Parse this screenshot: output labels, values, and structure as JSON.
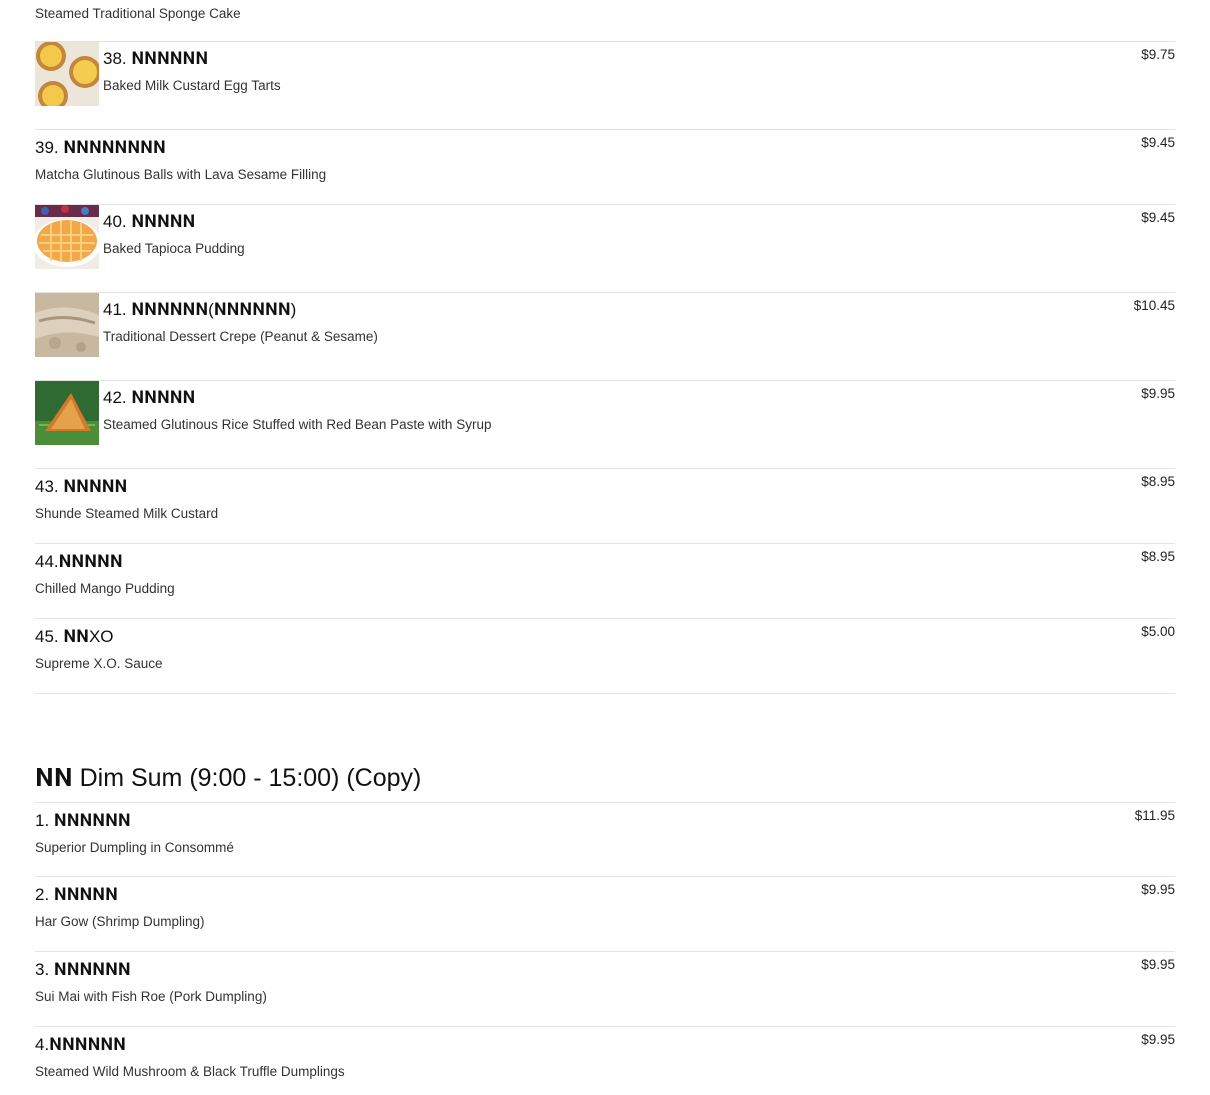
{
  "top_item": {
    "description": "Steamed Traditional Sponge Cake"
  },
  "items_a": [
    {
      "name": "38. 𝐍𝐍𝐍𝐍𝐍𝐍",
      "description": "Baked Milk Custard Egg Tarts",
      "price": "$9.75",
      "thumb": "egg-tarts-photo"
    },
    {
      "name": "39. 𝐍𝐍𝐍𝐍𝐍𝐍𝐍𝐍",
      "description": "Matcha Glutinous Balls with Lava Sesame Filling",
      "price": "$9.45"
    },
    {
      "name": "40. 𝐍𝐍𝐍𝐍𝐍",
      "description": "Baked Tapioca Pudding",
      "price": "$9.45",
      "thumb": "tapioca-pudding-photo"
    },
    {
      "name": "41. 𝐍𝐍𝐍𝐍𝐍𝐍(𝐍𝐍𝐍𝐍𝐍𝐍)",
      "description": "Traditional Dessert Crepe (Peanut & Sesame)",
      "price": "$10.45",
      "thumb": "dessert-crepe-photo"
    },
    {
      "name": "42. 𝐍𝐍𝐍𝐍𝐍",
      "description": "Steamed Glutinous Rice Stuffed with Red Bean Paste with Syrup",
      "price": "$9.95",
      "thumb": "glutinous-rice-photo"
    },
    {
      "name": "43. 𝐍𝐍𝐍𝐍𝐍",
      "description": "Shunde Steamed Milk Custard",
      "price": "$8.95"
    },
    {
      "name": "44.𝐍𝐍𝐍𝐍𝐍",
      "description": "Chilled Mango Pudding",
      "price": "$8.95"
    },
    {
      "name": "45. 𝐍𝐍XO",
      "description": "Supreme X.O. Sauce",
      "price": "$5.00"
    }
  ],
  "section": {
    "title": "𝐍𝐍 Dim Sum (9:00 - 15:00) (Copy)"
  },
  "items_b": [
    {
      "name": "1. 𝐍𝐍𝐍𝐍𝐍𝐍",
      "description": "Superior Dumpling in Consommé",
      "price": "$11.95"
    },
    {
      "name": "2. 𝐍𝐍𝐍𝐍𝐍",
      "description": "Har Gow (Shrimp Dumpling)",
      "price": "$9.95"
    },
    {
      "name": "3. 𝐍𝐍𝐍𝐍𝐍𝐍",
      "description": "Sui Mai with Fish Roe (Pork Dumpling)",
      "price": "$9.95"
    },
    {
      "name": "4.𝐍𝐍𝐍𝐍𝐍𝐍",
      "description": "Steamed Wild Mushroom & Black Truffle Dumplings",
      "price": "$9.95"
    }
  ],
  "colors": {
    "divider": "#e3e3e3",
    "text": "#222222"
  }
}
